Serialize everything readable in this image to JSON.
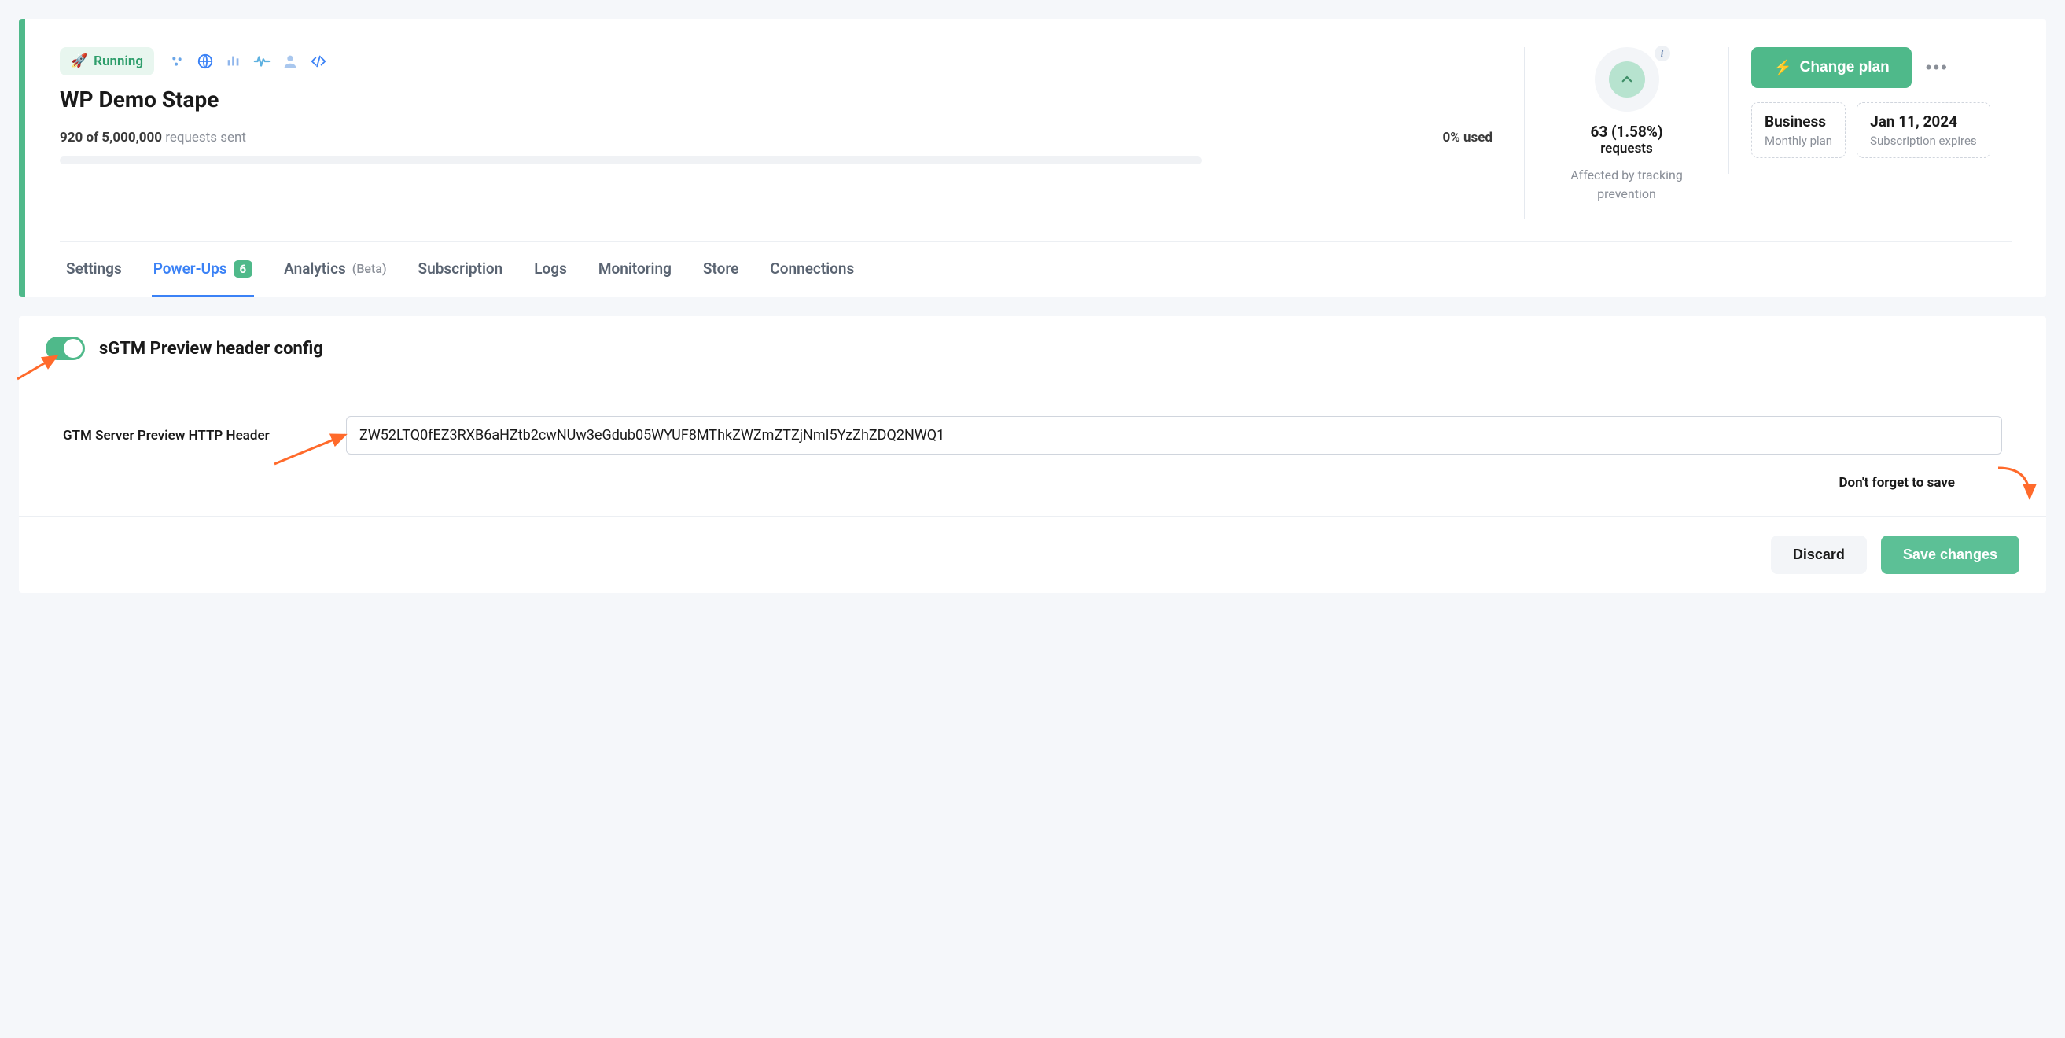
{
  "header": {
    "status": "Running",
    "title": "WP Demo Stape",
    "usage_count": "920 of 5,000,000",
    "usage_label": "requests sent",
    "usage_pct": "0% used"
  },
  "prevention": {
    "value": "63 (1.58%)",
    "unit": "requests",
    "caption": "Affected by tracking prevention"
  },
  "plan": {
    "change_btn": "Change plan",
    "name": "Business",
    "name_sub": "Monthly plan",
    "expires": "Jan 11, 2024",
    "expires_sub": "Subscription expires"
  },
  "tabs": [
    {
      "label": "Settings"
    },
    {
      "label": "Power-Ups",
      "badge": "6",
      "active": true
    },
    {
      "label": "Analytics",
      "beta": "(Beta)"
    },
    {
      "label": "Subscription"
    },
    {
      "label": "Logs"
    },
    {
      "label": "Monitoring"
    },
    {
      "label": "Store"
    },
    {
      "label": "Connections"
    }
  ],
  "config": {
    "title": "sGTM Preview header config",
    "field_label": "GTM Server Preview HTTP Header",
    "field_value": "ZW52LTQ0fEZ3RXB6aHZtb2cwNUw3eGdub05WYUF8MThkZWZmZTZjNmI5YzZhZDQ2NWQ1",
    "save_hint": "Don't forget to save",
    "discard_btn": "Discard",
    "save_btn": "Save changes"
  }
}
